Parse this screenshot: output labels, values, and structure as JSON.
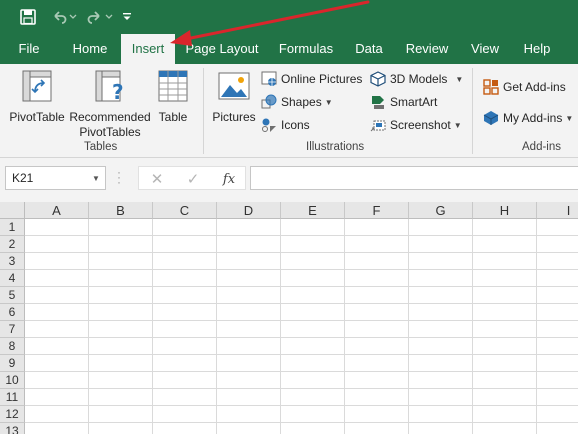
{
  "tabs": [
    {
      "label": "File"
    },
    {
      "label": "Home"
    },
    {
      "label": "Insert",
      "active": true
    },
    {
      "label": "Page Layout"
    },
    {
      "label": "Formulas"
    },
    {
      "label": "Data"
    },
    {
      "label": "Review"
    },
    {
      "label": "View"
    },
    {
      "label": "Help"
    }
  ],
  "ribbon": {
    "tables_group": {
      "label": "Tables",
      "pivottable": "PivotTable",
      "recommended_line1": "Recommended",
      "recommended_line2": "PivotTables",
      "table": "Table"
    },
    "illustrations_group": {
      "label": "Illustrations",
      "pictures": "Pictures",
      "online_pictures": "Online Pictures",
      "shapes": "Shapes",
      "icons": "Icons",
      "models_3d": "3D Models",
      "smartart": "SmartArt",
      "screenshot": "Screenshot"
    },
    "addins_group": {
      "label": "Add-ins",
      "get_addins": "Get Add-ins",
      "my_addins": "My Add-ins"
    }
  },
  "formula_bar": {
    "name_box": "K21",
    "cancel_symbol": "✕",
    "enter_symbol": "✓",
    "fx_label": "fx",
    "formula": ""
  },
  "sheet": {
    "columns": [
      "A",
      "B",
      "C",
      "D",
      "E",
      "F",
      "G",
      "H",
      "I"
    ],
    "rows": [
      "1",
      "2",
      "3",
      "4",
      "5",
      "6",
      "7",
      "8",
      "9",
      "10",
      "11",
      "12",
      "13"
    ]
  },
  "colors": {
    "brand": "#217346",
    "ribbon_bg": "#f3f3f3",
    "header_bg": "#e6e6e6",
    "annotation_arrow": "#d9262c"
  },
  "icons": {
    "save": "save-icon",
    "undo": "undo-icon",
    "redo": "redo-icon",
    "customize": "customize-quick-access-icon"
  }
}
